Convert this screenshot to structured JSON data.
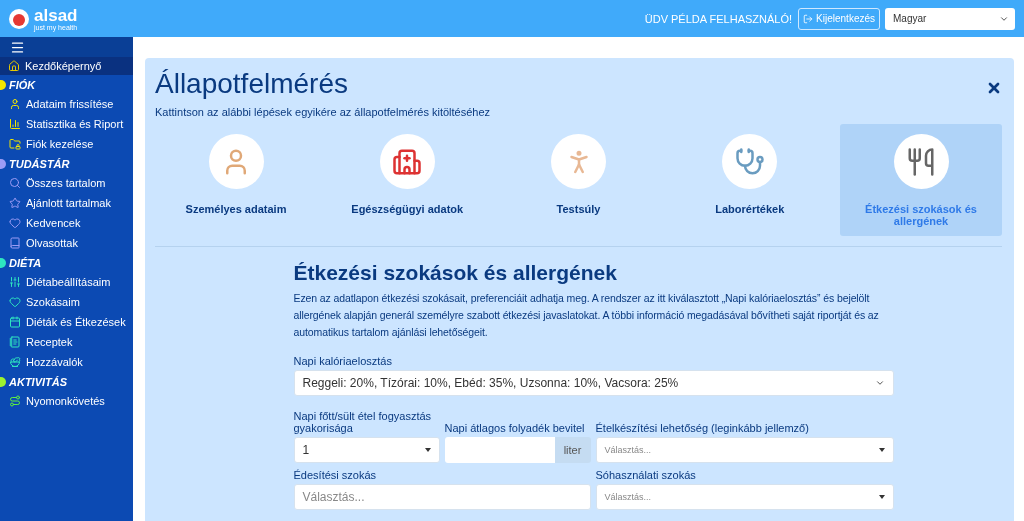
{
  "header": {
    "logo": "alsad",
    "tagline": "just my health",
    "greeting": "ÜDV PÉLDA FELHASZNÁLÓ!",
    "logout": "Kijelentkezés",
    "language": "Magyar"
  },
  "sidebar": {
    "home": {
      "label": "Kezdőképernyő",
      "selected": true
    },
    "sections": [
      {
        "title": "FIÓK",
        "color": "#f2e600",
        "items": [
          "Adataim frissítése",
          "Statisztika és Riport",
          "Fiók kezelése"
        ]
      },
      {
        "title": "TUDÁSTÁR",
        "color": "#9c9cf5",
        "items": [
          "Összes tartalom",
          "Ajánlott tartalmak",
          "Kedvencek",
          "Olvasottak"
        ]
      },
      {
        "title": "DIÉTA",
        "color": "#2ee6c0",
        "items": [
          "Diétabeállításaim",
          "Szokásaim",
          "Diéták és Étkezések",
          "Receptek",
          "Hozzávalók"
        ]
      },
      {
        "title": "AKTIVITÁS",
        "color": "#9cf22e",
        "items": [
          "Nyomonkövetés"
        ]
      }
    ]
  },
  "panel": {
    "title": "Állapotfelmérés",
    "subtitle": "Kattintson az alábbi lépések egyikére az állapotfelmérés kitöltéséhez",
    "steps": [
      {
        "label": "Személyes adataim",
        "selected": false
      },
      {
        "label": "Egészségügyi adatok",
        "selected": false
      },
      {
        "label": "Testsúly",
        "selected": false
      },
      {
        "label": "Laborértékek",
        "selected": false
      },
      {
        "label": "Étkezési szokások és allergének",
        "selected": true
      }
    ]
  },
  "form": {
    "title": "Étkezési szokások és allergének",
    "description": "Ezen az adatlapon étkezési szokásait, preferenciáit adhatja meg. A rendszer az itt kiválasztott „Napi kalóriaelosztás” és bejelölt allergének alapján generál személyre szabott étkezési javaslatokat. A többi információ megadásával bővítheti saját riportját és az automatikus tartalom ajánlási lehetőségeit.",
    "calorie": {
      "label": "Napi kalóriaelosztás",
      "value": "Reggeli: 20%, Tízórai: 10%, Ebéd: 35%, Uzsonna: 10%, Vacsora: 25%"
    },
    "cooked": {
      "label": "Napi főtt/sült étel fogyasztás gyakorisága",
      "value": "1"
    },
    "fluid": {
      "label": "Napi átlagos folyadék bevitel",
      "unit": "liter"
    },
    "cooking": {
      "label": "Ételkészítési lehetőség (leginkább jellemző)",
      "placeholder": "Választás..."
    },
    "sweetening": {
      "label": "Édesítési szokás",
      "placeholder": "Választás..."
    },
    "salt": {
      "label": "Sóhasználati szokás",
      "placeholder": "Választás..."
    }
  }
}
